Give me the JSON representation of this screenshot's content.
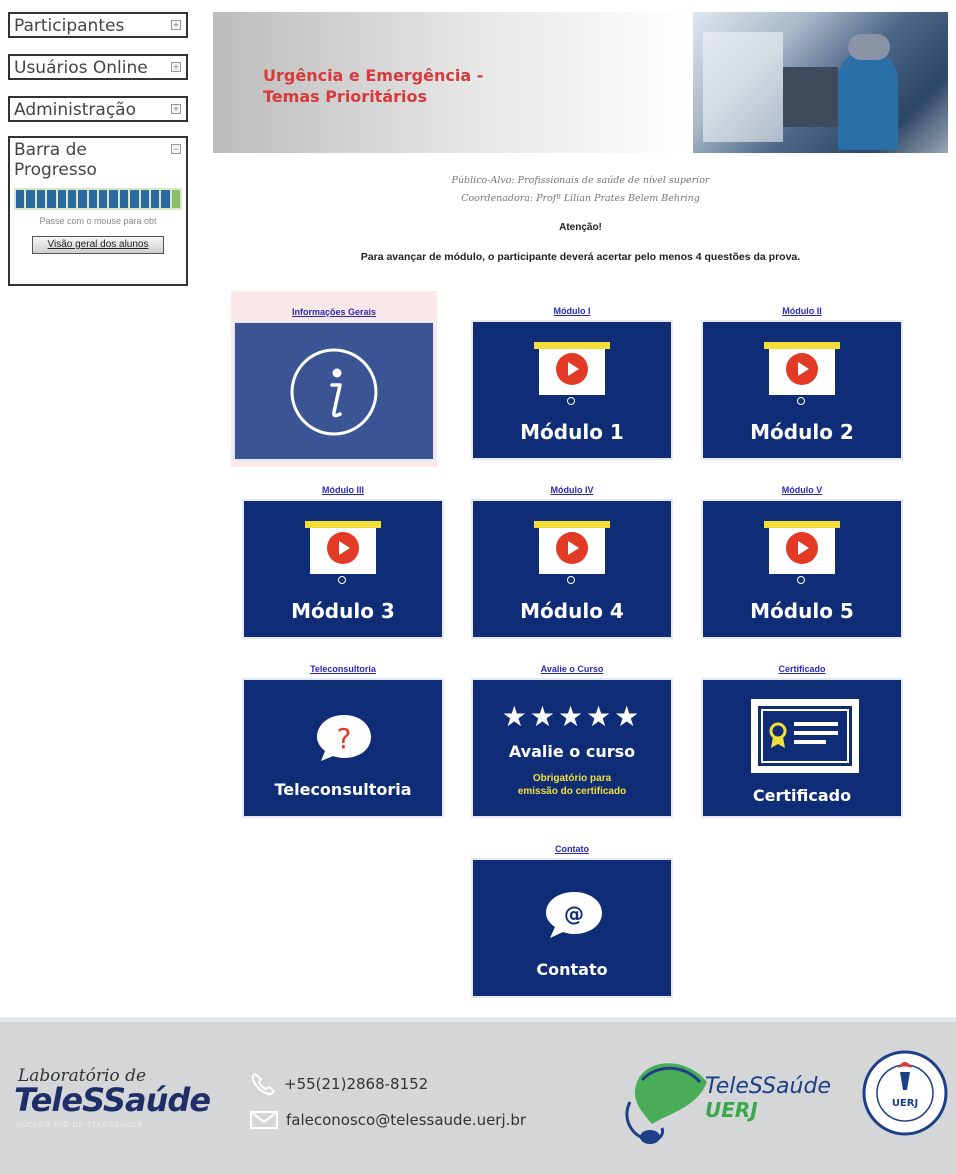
{
  "sidebar": {
    "participants": "Participantes",
    "online_users": "Usuários Online",
    "administration": "Administração",
    "progress_title": "Barra de Progresso",
    "progress_hint": "Passe com o mouse para obt",
    "overview_button": "Visão geral dos alunos",
    "progress_segments": 16,
    "colors": {
      "segment": "#2b6aa0",
      "segment_done": "#8abe6a"
    }
  },
  "banner": {
    "title_line1": "Urgência e Emergência -",
    "title_line2": "Temas Prioritários"
  },
  "info": {
    "audience": "Público-Alvo: Profissionais de saúde de nível superior",
    "coordinator": "Coordenadora: Profª Lilian Prates Belem Behring",
    "attention": "Atenção!",
    "rule": "Para avançar de módulo, o participante deverá acertar pelo menos 4 questões da prova."
  },
  "tiles": {
    "info": {
      "link": "Informações Gerais",
      "icon": "info-icon"
    },
    "m1": {
      "link": "Módulo I",
      "caption": "Módulo 1",
      "icon": "video-projector-icon"
    },
    "m2": {
      "link": "Módulo II",
      "caption": "Módulo 2",
      "icon": "video-projector-icon"
    },
    "m3": {
      "link": "Módulo III",
      "caption": "Módulo 3",
      "icon": "video-projector-icon"
    },
    "m4": {
      "link": "Módulo IV",
      "caption": "Módulo 4",
      "icon": "video-projector-icon"
    },
    "m5": {
      "link": "Módulo V",
      "caption": "Módulo 5",
      "icon": "video-projector-icon"
    },
    "teleconsult": {
      "link": "Teleconsultoria",
      "caption": "Teleconsultoria",
      "icon": "question-bubble-icon"
    },
    "rate": {
      "link": "Avalie o Curso",
      "caption": "Avalie o curso",
      "stars": "★★★★★",
      "note_line1": "Obrigatório para",
      "note_line2": "emissão do certificado",
      "icon": "star-icon"
    },
    "certificate": {
      "link": "Certificado",
      "caption": "Certificado",
      "icon": "certificate-icon"
    },
    "contact": {
      "link": "Contato",
      "caption": "Contato",
      "icon": "at-bubble-icon"
    }
  },
  "footer": {
    "lab_small": "Laboratório de",
    "lab_big": "TeleSSaúde",
    "lab_tag": "NÚCLEO RIO DE TELESSAÚDE",
    "phone": "+55(21)2868-8152",
    "email": "faleconosco@telessaude.uerj.br",
    "telessaude_name": "TeleSSaúde",
    "telessaude_uerj": "UERJ",
    "seal_text": "UERJ"
  },
  "colors": {
    "tile_bg": "#0f2d77",
    "info_tile_bg": "#3a5494",
    "banner_title": "#d83b3b",
    "link": "#2a2ab8",
    "accent_yellow": "#f3df3a",
    "play_red": "#e23a25"
  }
}
